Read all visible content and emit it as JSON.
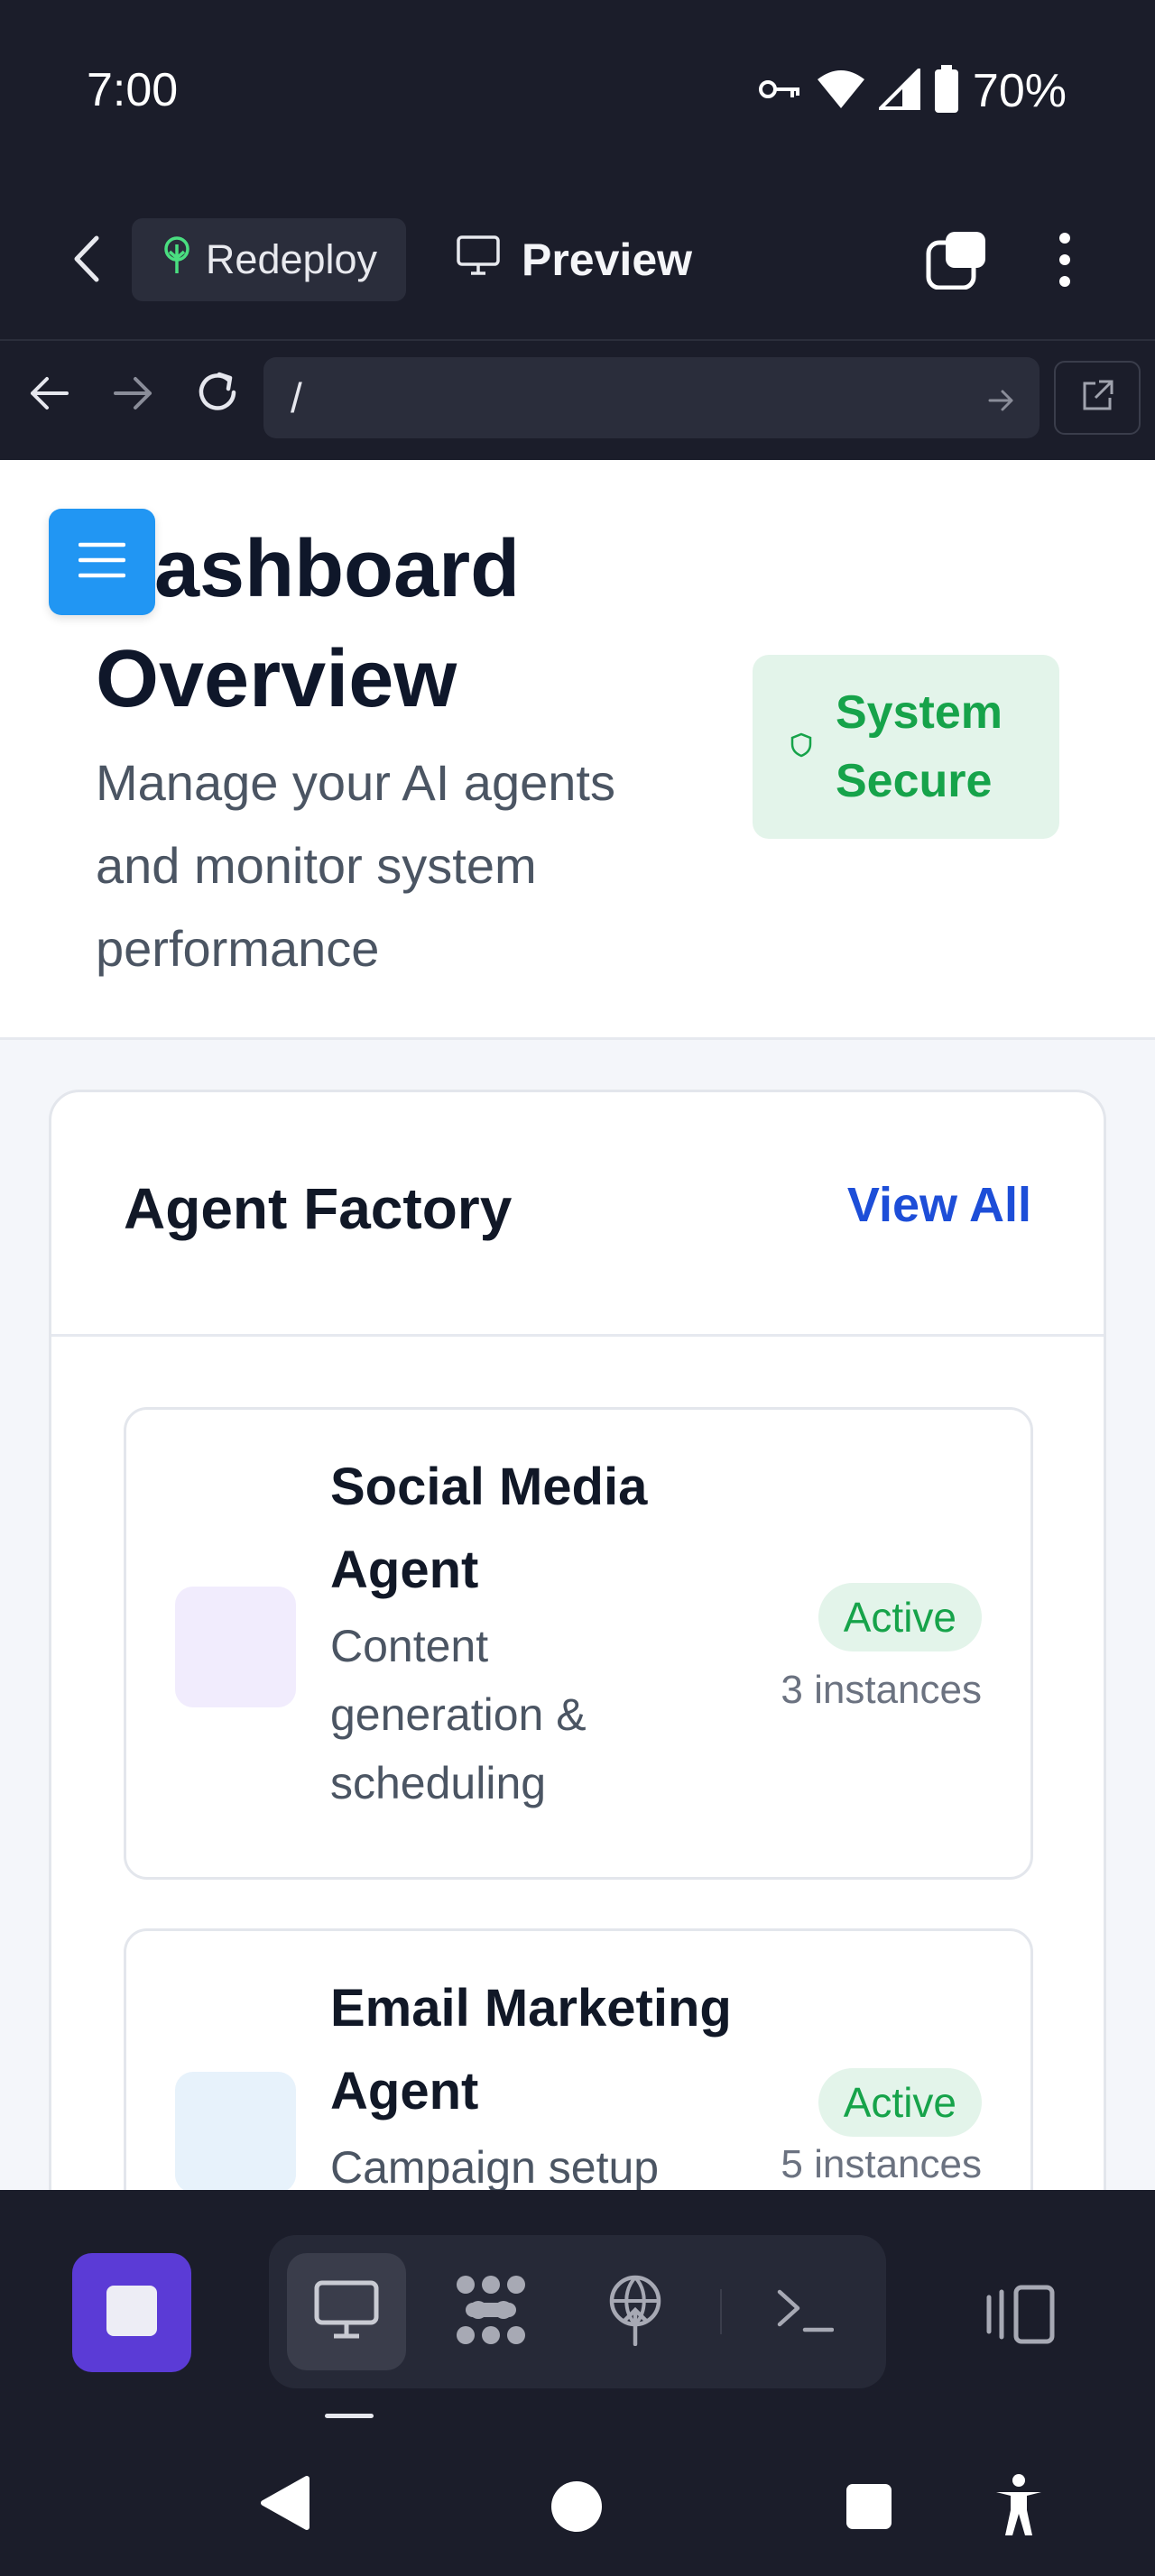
{
  "status_bar": {
    "time": "7:00",
    "battery": "70%"
  },
  "app_header": {
    "redeploy_label": "Redeploy",
    "preview_label": "Preview"
  },
  "url_bar": {
    "value": "/"
  },
  "page": {
    "title": "Dashboard Overview",
    "subtitle": "Manage your AI agents and monitor system performance",
    "security_badge": "System Secure"
  },
  "agent_factory": {
    "title": "Agent Factory",
    "view_all": "View All",
    "agents": [
      {
        "name": "Social Media Agent",
        "description": "Content generation & scheduling",
        "status": "Active",
        "instances": "3 instances",
        "icon_color": "#f1ecfd"
      },
      {
        "name": "Email Marketing Agent",
        "description": "Campaign setup & automation",
        "status": "Active",
        "instances": "5 instances",
        "icon_color": "#e7f2fb"
      }
    ]
  },
  "colors": {
    "accent_blue": "#2196f3",
    "success_green": "#16a34a",
    "stop_purple": "#5b3bd6",
    "chrome_dark": "#1b1d2a"
  }
}
